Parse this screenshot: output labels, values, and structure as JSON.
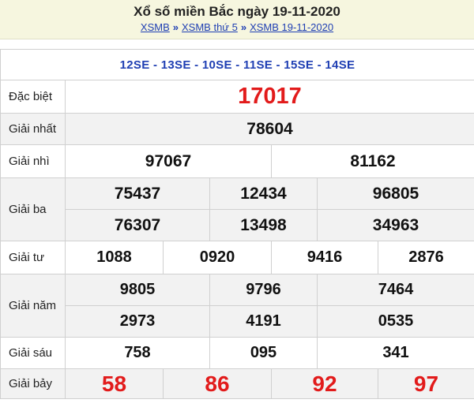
{
  "header": {
    "title": "Xổ số miền Bắc ngày 19-11-2020",
    "breadcrumb": [
      "XSMB",
      "XSMB thứ 5",
      "XSMB 19-11-2020"
    ],
    "separator": "»"
  },
  "codes": "12SE - 13SE - 10SE - 11SE - 15SE - 14SE",
  "prizes": {
    "special": {
      "label": "Đặc biệt",
      "numbers": [
        "17017"
      ]
    },
    "first": {
      "label": "Giải nhất",
      "numbers": [
        "78604"
      ]
    },
    "second": {
      "label": "Giải nhì",
      "numbers": [
        "97067",
        "81162"
      ]
    },
    "third": {
      "label": "Giải ba",
      "numbers": [
        "75437",
        "12434",
        "96805",
        "76307",
        "13498",
        "34963"
      ]
    },
    "fourth": {
      "label": "Giải tư",
      "numbers": [
        "1088",
        "0920",
        "9416",
        "2876"
      ]
    },
    "fifth": {
      "label": "Giải năm",
      "numbers": [
        "9805",
        "9796",
        "7464",
        "2973",
        "4191",
        "0535"
      ]
    },
    "sixth": {
      "label": "Giải sáu",
      "numbers": [
        "758",
        "095",
        "341"
      ]
    },
    "seventh": {
      "label": "Giải bảy",
      "numbers": [
        "58",
        "86",
        "92",
        "97"
      ]
    }
  },
  "colors": {
    "accent_red": "#e21b1b",
    "link_blue": "#1f3fb3",
    "header_bg": "#f6f6df",
    "row_grey": "#f2f2f2"
  }
}
